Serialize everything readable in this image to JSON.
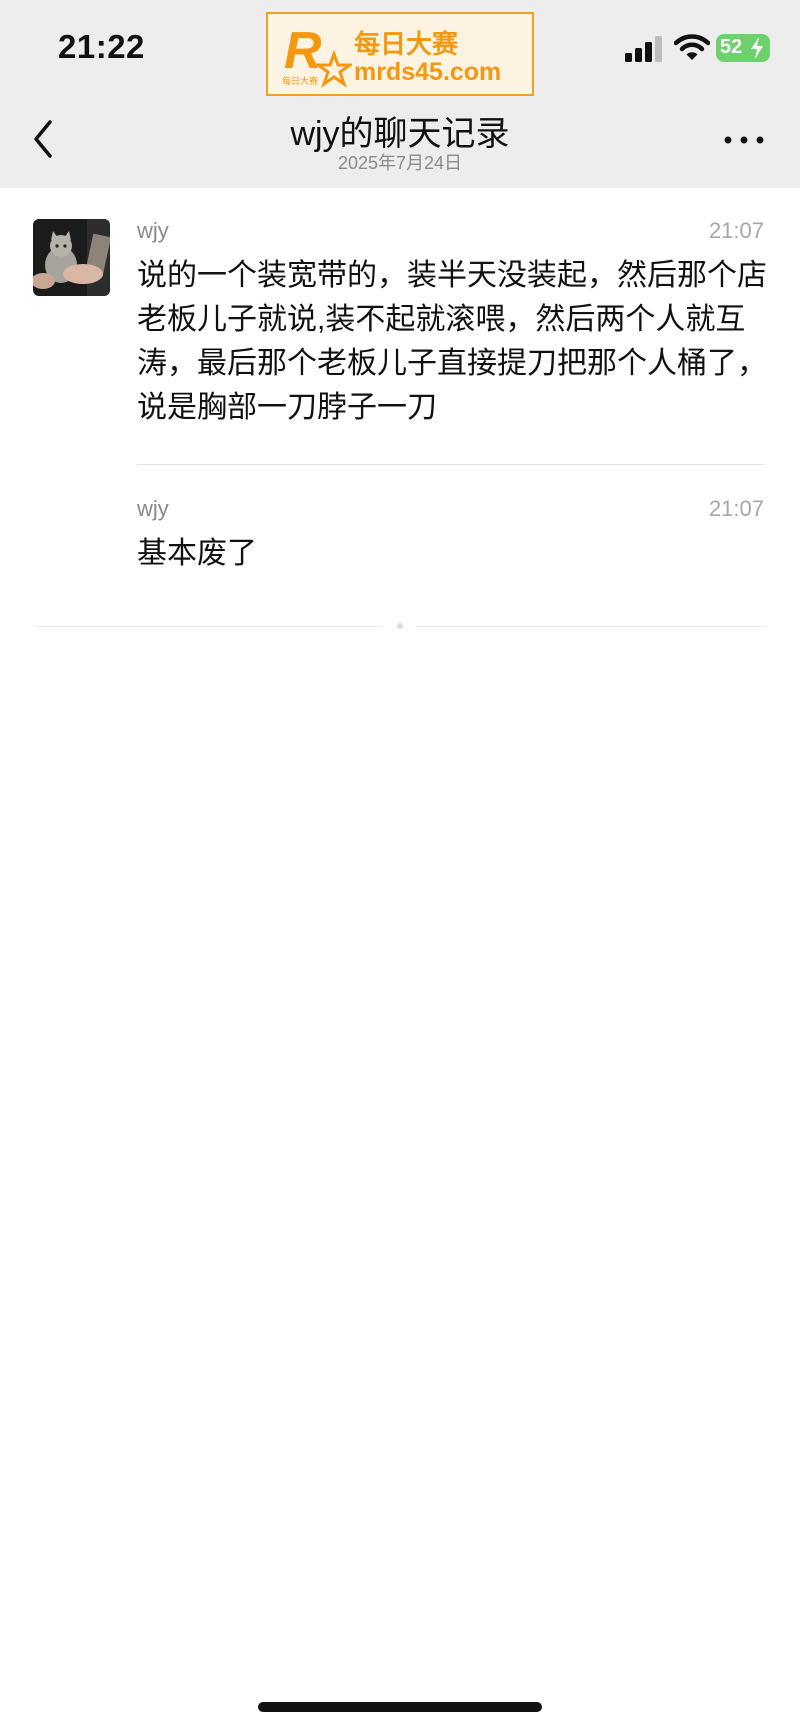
{
  "status_bar": {
    "time": "21:22",
    "battery": "52",
    "icons": [
      "signal-icon",
      "wifi-icon",
      "battery-icon"
    ]
  },
  "ad": {
    "logo_letter": "R",
    "logo_caption": "每日大赛",
    "line1": "每日大赛",
    "line2": "mrds45.com",
    "color": "#f49812"
  },
  "header": {
    "title": "wjy的聊天记录",
    "subtitle": "2025年7月24日",
    "icons": [
      "back-icon",
      "more-icon"
    ]
  },
  "messages": [
    {
      "sender": "wjy",
      "time": "21:07",
      "text": "说的一个装宽带的，装半天没装起，然后那个店老板儿子就说,装不起就滚喂，然后两个人就互涛，最后那个老板儿子直接提刀把那个人桶了，说是胸部一刀脖子一刀"
    },
    {
      "sender": "wjy",
      "time": "21:07",
      "text": "基本废了"
    }
  ],
  "colors": {
    "header_bg": "#ededed",
    "page_bg": "#ffffff",
    "battery_green": "#6dd26d",
    "secondary_text": "#8a8a8a"
  }
}
